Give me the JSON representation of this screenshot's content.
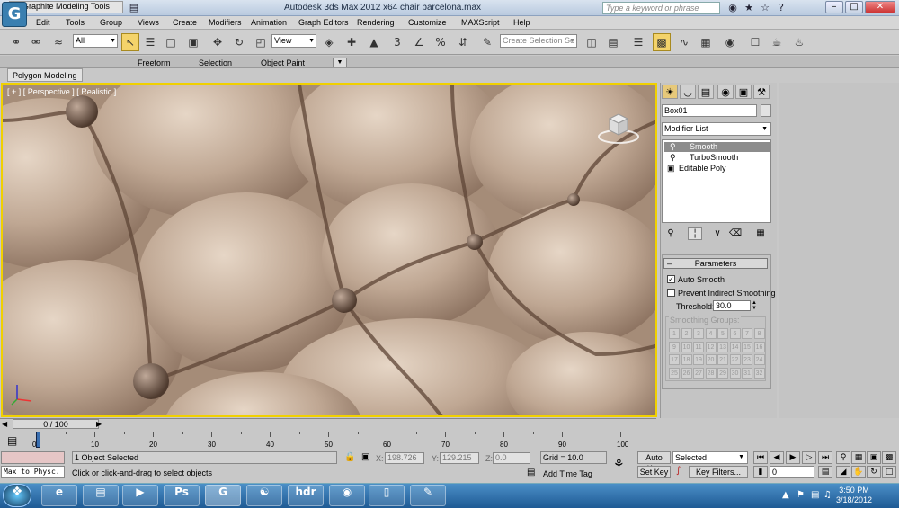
{
  "title_bar": {
    "app_title": "Autodesk 3ds Max  2012 x64     chair barcelona.max",
    "search_placeholder": "Type a keyword or phrase"
  },
  "menu": [
    "Edit",
    "Tools",
    "Group",
    "Views",
    "Create",
    "Modifiers",
    "Animation",
    "Graph Editors",
    "Rendering",
    "Customize",
    "MAXScript",
    "Help"
  ],
  "toolbar": {
    "selection_filter": "All",
    "reference_coord": "View",
    "named_selection_placeholder": "Create Selection Se",
    "snap_label": "3"
  },
  "ribbon": {
    "tabs": [
      "Graphite Modeling Tools",
      "Freeform",
      "Selection",
      "Object Paint"
    ],
    "sub_tab": "Polygon Modeling"
  },
  "viewport": {
    "label": "[ + ] [ Perspective ] [ Realistic ]"
  },
  "command_panel": {
    "object_name": "Box01",
    "modifier_list_label": "Modifier List",
    "stack": [
      {
        "label": "Smooth",
        "selected": true
      },
      {
        "label": "TurboSmooth",
        "selected": false
      },
      {
        "label": "Editable Poly",
        "selected": false
      }
    ],
    "parameters": {
      "title": "Parameters",
      "auto_smooth_label": "Auto Smooth",
      "auto_smooth_checked": true,
      "prevent_indirect_label": "Prevent Indirect Smoothing",
      "prevent_indirect_checked": false,
      "threshold_label": "Threshold:",
      "threshold_value": "30.0",
      "smoothing_groups_label": "Smoothing Groups:",
      "groups": [
        "1",
        "2",
        "3",
        "4",
        "5",
        "6",
        "7",
        "8",
        "9",
        "10",
        "11",
        "12",
        "13",
        "14",
        "15",
        "16",
        "17",
        "18",
        "19",
        "20",
        "21",
        "22",
        "23",
        "24",
        "25",
        "26",
        "27",
        "28",
        "29",
        "30",
        "31",
        "32"
      ]
    }
  },
  "timeline": {
    "slider_label": "0 / 100",
    "ticks": [
      "0",
      "10",
      "20",
      "30",
      "40",
      "50",
      "60",
      "70",
      "80",
      "90",
      "100"
    ]
  },
  "status": {
    "maxscript": "Max to Physc.",
    "selection_info": "1 Object Selected",
    "prompt": "Click or click-and-drag to select objects",
    "x_label": "X:",
    "x_value": "198.726",
    "y_label": "Y:",
    "y_value": "129.215",
    "z_label": "Z:",
    "z_value": "0.0",
    "grid": "Grid = 10.0",
    "add_time_tag": "Add Time Tag",
    "auto_key": "Auto Key",
    "set_key": "Set Key",
    "key_mode": "Selected",
    "key_filters": "Key Filters...",
    "frame": "0"
  },
  "taskbar": {
    "time": "3:50 PM",
    "date": "3/18/2012"
  },
  "colors": {
    "viewport_border": "#f0d000",
    "active_tool": "#f4d36a",
    "leather": "#b39a86"
  }
}
